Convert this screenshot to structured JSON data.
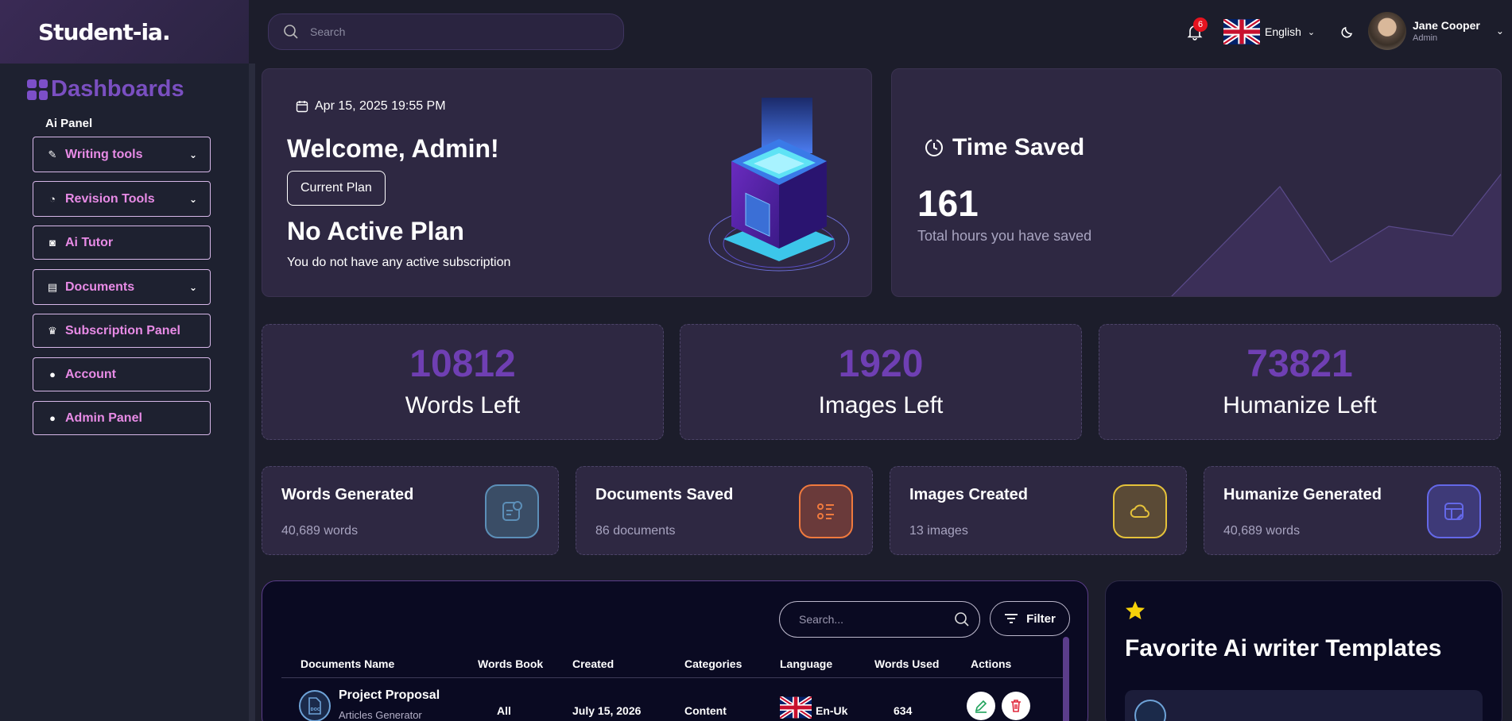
{
  "sidebar": {
    "logo": "Student-ia.",
    "section_title": "Dashboards",
    "panel_label": "Ai Panel",
    "items": [
      {
        "label": "Writing tools",
        "icon": "pencil-icon",
        "dropdown": true
      },
      {
        "label": "Revision Tools",
        "icon": "check-circle-icon",
        "dropdown": true
      },
      {
        "label": "Ai Tutor",
        "icon": "robot-icon",
        "dropdown": false
      },
      {
        "label": "Documents",
        "icon": "file-icon",
        "dropdown": true
      },
      {
        "label": "Subscription Panel",
        "icon": "crown-icon",
        "dropdown": false
      },
      {
        "label": "Account",
        "icon": "user-icon",
        "dropdown": false
      },
      {
        "label": "Admin Panel",
        "icon": "user-icon",
        "dropdown": false
      }
    ]
  },
  "topbar": {
    "search_placeholder": "Search",
    "notification_count": "6",
    "language": "English",
    "user_name": "Jane Cooper",
    "user_role": "Admin"
  },
  "welcome": {
    "date": "Apr 15, 2025 19:55 PM",
    "title": "Welcome, Admin!",
    "plan_button": "Current Plan",
    "plan_status": "No Active Plan",
    "plan_note": "You do not have any active subscription"
  },
  "time_saved": {
    "title": "Time Saved",
    "value": "161",
    "subtitle": "Total hours you have saved"
  },
  "stats": [
    {
      "value": "10812",
      "label": "Words Left"
    },
    {
      "value": "1920",
      "label": "Images Left"
    },
    {
      "value": "73821",
      "label": "Humanize Left"
    }
  ],
  "mini_cards": [
    {
      "title": "Words Generated",
      "sub": "40,689 words",
      "color": "#5c8fb8",
      "icon": "document-check-icon"
    },
    {
      "title": "Documents Saved",
      "sub": "86 documents",
      "color": "#f07a3e",
      "icon": "list-icon"
    },
    {
      "title": "Images Created",
      "sub": "13 images",
      "color": "#e5c23a",
      "icon": "cloud-icon"
    },
    {
      "title": "Humanize Generated",
      "sub": "40,689 words",
      "color": "#6468e8",
      "icon": "table-edit-icon"
    }
  ],
  "documents": {
    "search_placeholder": "Search...",
    "filter_label": "Filter",
    "columns": [
      "Documents Name",
      "Words Book",
      "Created",
      "Categories",
      "Language",
      "Words Used",
      "Actions"
    ],
    "rows": [
      {
        "name": "Project Proposal",
        "generator": "Articles Generator",
        "words_book": "All",
        "created": "July 15, 2026",
        "category": "Content",
        "language": "En-Uk",
        "words_used": "634"
      }
    ]
  },
  "favorites": {
    "title": "Favorite Ai writer Templates"
  }
}
